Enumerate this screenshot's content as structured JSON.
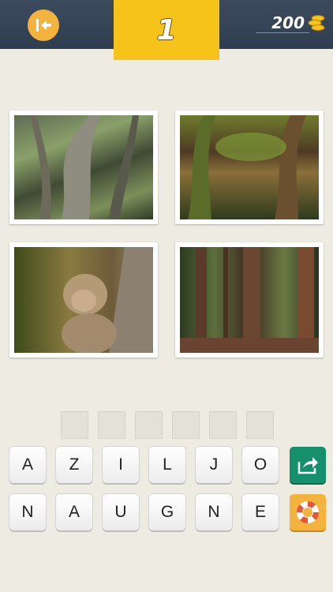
{
  "header": {
    "back_icon": "back-arrow-icon",
    "level": "1",
    "coins": "200",
    "coins_icon": "coin-stack-icon"
  },
  "photos": [
    {
      "subject": "vines-tree"
    },
    {
      "subject": "fern-forest"
    },
    {
      "subject": "monkey-tree"
    },
    {
      "subject": "redwood-forest"
    }
  ],
  "answer_slots": 6,
  "keyboard": {
    "row1": [
      "A",
      "Z",
      "I",
      "L",
      "J",
      "O"
    ],
    "row2": [
      "N",
      "A",
      "U",
      "G",
      "N",
      "E"
    ]
  },
  "actions": {
    "share_icon": "share-icon",
    "help_icon": "lifebuoy-icon"
  },
  "colors": {
    "topbar": "#334155",
    "level_box": "#f5c319",
    "back_button": "#f3b33d",
    "share_button": "#14906a",
    "help_button": "#f3b33d",
    "background": "#eeece2"
  }
}
